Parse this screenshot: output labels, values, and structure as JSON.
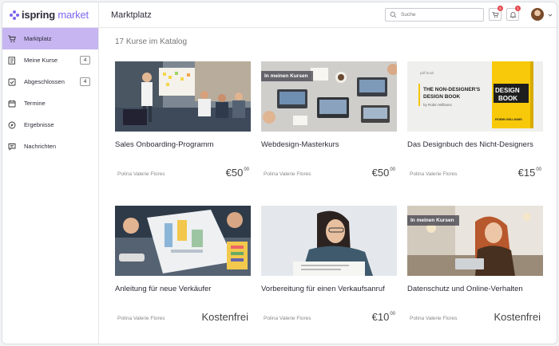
{
  "app": {
    "logo_prefix": "ispring",
    "logo_suffix": " market",
    "brand_color": "#7b68ee"
  },
  "sidebar": {
    "items": [
      {
        "label": "Marktplatz",
        "icon": "cart-icon",
        "active": true,
        "badge": ""
      },
      {
        "label": "Meine Kurse",
        "icon": "book-list-icon",
        "badge": "4"
      },
      {
        "label": "Abgeschlossen",
        "icon": "check-box-icon",
        "badge": "4"
      },
      {
        "label": "Termine",
        "icon": "calendar-icon",
        "badge": ""
      },
      {
        "label": "Ergebnisse",
        "icon": "compass-icon",
        "badge": ""
      },
      {
        "label": "Nachrichten",
        "icon": "message-icon",
        "badge": ""
      }
    ]
  },
  "header": {
    "title": "Marktplatz",
    "search_placeholder": "Suche",
    "cart_count": "5",
    "notification_count": "1"
  },
  "main": {
    "catalog_count": "17 Kurse im Katalog",
    "courses": [
      {
        "title": "Sales Onboarding-Programm",
        "author": "Polina Valerie Flores",
        "price_main": "€50",
        "price_cents": "00",
        "tag": ""
      },
      {
        "title": "Webdesign-Masterkurs",
        "author": "Polina Valerie Flores",
        "price_main": "€50",
        "price_cents": "00",
        "tag": "In meinen Kursen"
      },
      {
        "title": "Das Designbuch des Nicht-Designers",
        "author": "Polina Valerie Flores",
        "price_main": "€15",
        "price_cents": "00",
        "tag": ""
      },
      {
        "title": "Anleitung für neue Verkäufer",
        "author": "Polina Valerie Flores",
        "price_main": "Kostenfrei",
        "price_cents": "",
        "tag": ""
      },
      {
        "title": "Vorbereitung für einen Verkaufsanruf",
        "author": "Polina Valerie Flores",
        "price_main": "€10",
        "price_cents": "00",
        "tag": ""
      },
      {
        "title": "Datenschutz und Online-Verhalten",
        "author": "Polina Valerie Flores",
        "price_main": "Kostenfrei",
        "price_cents": "",
        "tag": "In meinen Kursen"
      }
    ],
    "book_cover": {
      "kicker": "pdf-book",
      "title_line1": "THE NON-DESIGNER'S",
      "title_line2": "DESIGN BOOK",
      "byline": "by Robin Williams",
      "cover_word1": "DESIGN",
      "cover_word2": "BOOK",
      "cover_author": "ROBIN WILLIAMS"
    }
  }
}
